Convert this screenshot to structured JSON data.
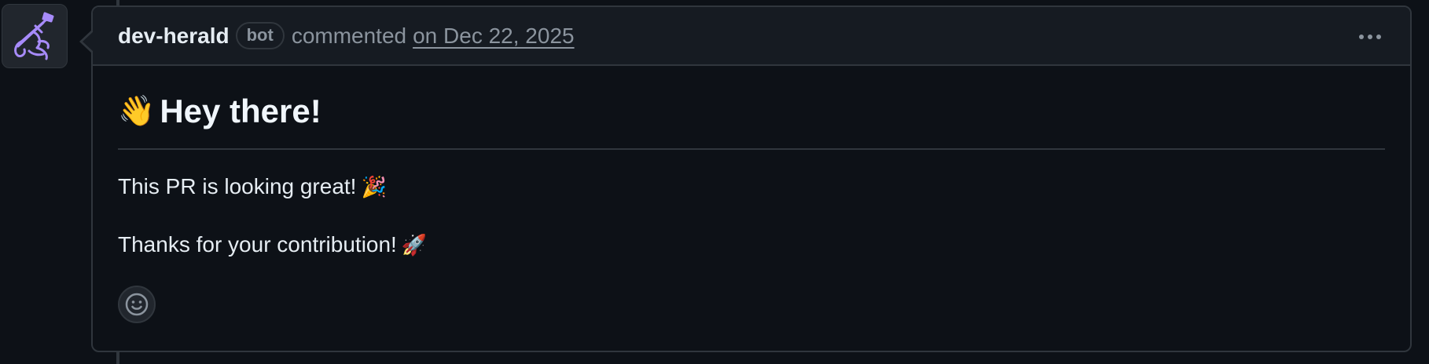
{
  "comment": {
    "author": "dev-herald",
    "badge": "bot",
    "action": "commented",
    "date": "on Dec 22, 2025",
    "heading_emoji": "👋",
    "heading": "Hey there!",
    "paragraphs": [
      {
        "text": "This PR is looking great!",
        "emoji": "🎉"
      },
      {
        "text": "Thanks for your contribution!",
        "emoji": "🚀"
      }
    ]
  },
  "icons": {
    "avatar": "trumpet-herald-icon",
    "more": "kebab-horizontal-icon",
    "reaction": "smiley-icon"
  },
  "colors": {
    "background": "#0d1117",
    "header_background": "#161b22",
    "border": "#30363d",
    "muted_text": "#8b949e",
    "avatar_accent": "#a78bfa"
  }
}
